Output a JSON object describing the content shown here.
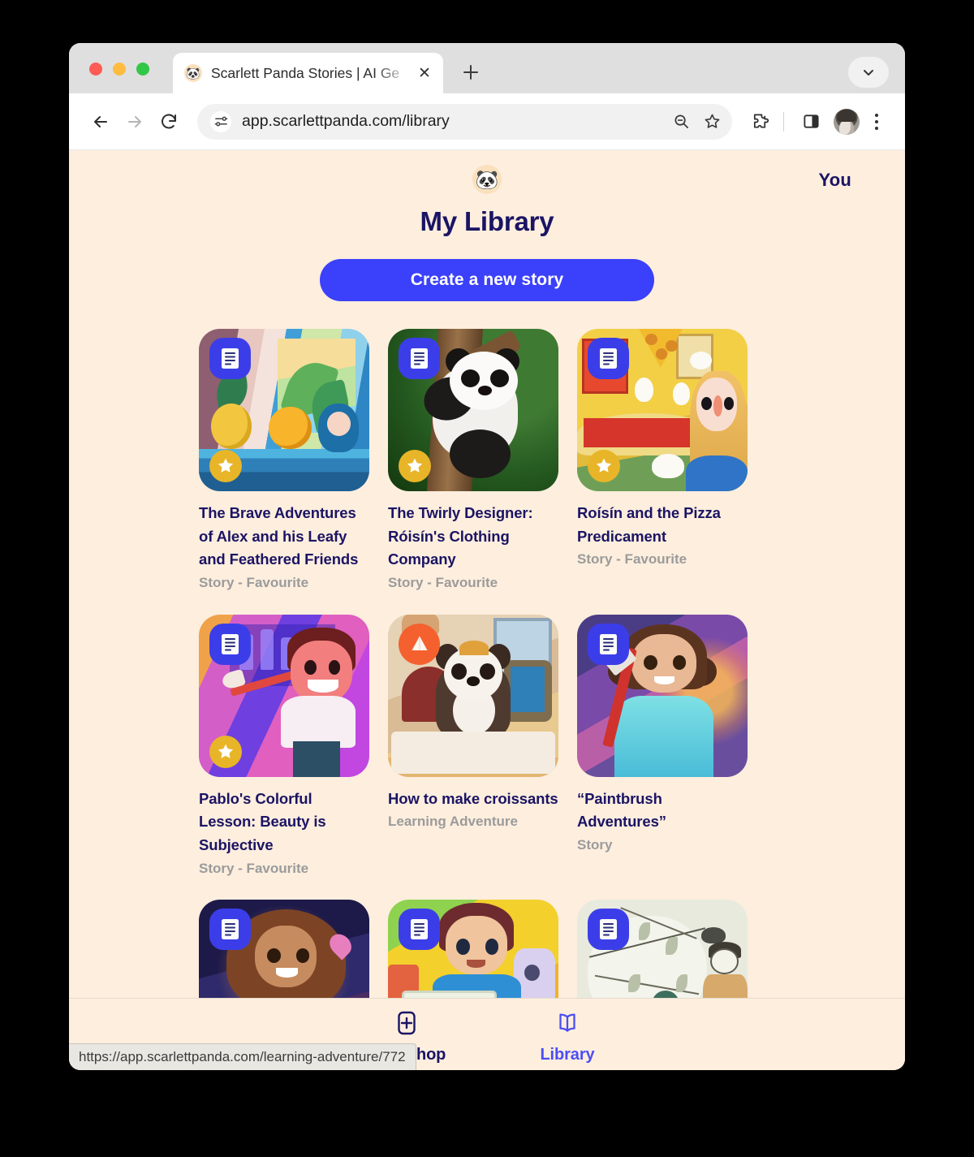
{
  "browser": {
    "tab": {
      "title": "Scarlett Panda Stories | AI Ge",
      "favicon": "🐼",
      "close_label": "✕"
    },
    "new_tab_label": "+",
    "omnibox": {
      "url": "app.scarlettpanda.com/library"
    },
    "status_bubble": {
      "url": "https://app.scarlettpanda.com/learning-adventure/772"
    }
  },
  "app": {
    "logo_glyph": "🐼",
    "account_link": "You",
    "page_title": "My Library",
    "create_button": "Create a new story"
  },
  "library": {
    "cards": [
      {
        "title": "The Brave Adventures of Alex and his Leafy and Feathered Friends",
        "subtitle": "Story - Favourite",
        "type_badge": "document-icon",
        "favourite": true,
        "scene": "birds"
      },
      {
        "title": "The Twirly Designer: Róisín's Clothing Company",
        "subtitle": "Story - Favourite",
        "type_badge": "document-icon",
        "favourite": true,
        "scene": "panda"
      },
      {
        "title": "Roísín and the Pizza Predicament",
        "subtitle": "Story - Favourite",
        "type_badge": "document-icon",
        "favourite": true,
        "scene": "pizza"
      },
      {
        "title": "Pablo's Colorful Lesson: Beauty is Subjective",
        "subtitle": "Story - Favourite",
        "type_badge": "document-icon",
        "favourite": true,
        "scene": "pablo"
      },
      {
        "title": "How to make croissants",
        "subtitle": "Learning Adventure",
        "type_badge": "learning-adventure-icon",
        "favourite": false,
        "scene": "croissant"
      },
      {
        "title": "“Paintbrush Adventures”",
        "subtitle": "Story",
        "type_badge": "document-icon",
        "favourite": false,
        "scene": "paintbrush"
      },
      {
        "title": "",
        "subtitle": "",
        "type_badge": "document-icon",
        "favourite": false,
        "scene": "reading"
      },
      {
        "title": "",
        "subtitle": "",
        "type_badge": "document-icon",
        "favourite": false,
        "scene": "laptop"
      },
      {
        "title": "",
        "subtitle": "",
        "type_badge": "document-icon",
        "favourite": false,
        "scene": "sketch"
      }
    ]
  },
  "bottom_nav": {
    "items": [
      {
        "label": "Workshop",
        "icon": "plus-square-icon",
        "active": false
      },
      {
        "label": "Library",
        "icon": "open-book-icon",
        "active": true
      }
    ]
  },
  "colors": {
    "page_background": "#FDEEDE",
    "primary_blue": "#3B40FA",
    "title_navy": "#1B1464",
    "subtitle_grey": "#9B9B9B",
    "star_gold": "#E8B529",
    "learning_orange": "#F4612F"
  }
}
